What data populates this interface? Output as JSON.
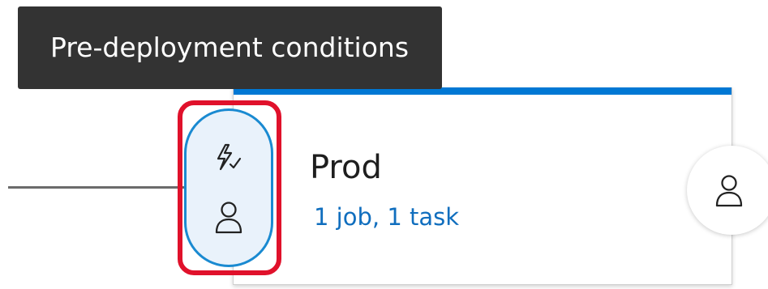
{
  "tooltip": {
    "text": "Pre-deployment conditions"
  },
  "stage": {
    "name": "Prod",
    "summary": "1 job, 1 task"
  },
  "pre_deployment": {
    "icons": [
      "lightning-icon",
      "person-icon"
    ]
  },
  "post_deployment": {
    "icon": "person-icon"
  },
  "colors": {
    "accent": "#0078d4",
    "highlight": "#e0112b",
    "tooltip_bg": "#333333",
    "link": "#106ebe",
    "pill_bg": "#e9f2fb"
  }
}
